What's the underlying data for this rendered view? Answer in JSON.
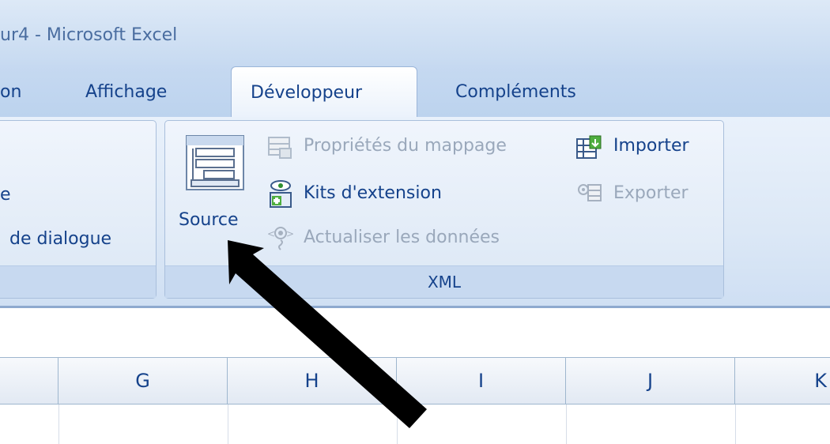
{
  "window": {
    "title": "ur4 - Microsoft Excel"
  },
  "tabs": {
    "partial": "on",
    "affichage": "Affichage",
    "developpeur": "Développeur",
    "complements": "Compléments"
  },
  "ribbon": {
    "left_group": {
      "line1": "e",
      "line2": "de dialogue"
    },
    "xml_group": {
      "label": "XML",
      "source": "Source",
      "proprietes": "Propriétés du mappage",
      "kits": "Kits d'extension",
      "actualiser": "Actualiser les données",
      "importer": "Importer",
      "exporter": "Exporter"
    }
  },
  "columns": [
    "G",
    "H",
    "I",
    "J",
    "K"
  ],
  "annotation": {
    "icon": "pointer-arrow",
    "color": "#000000"
  }
}
